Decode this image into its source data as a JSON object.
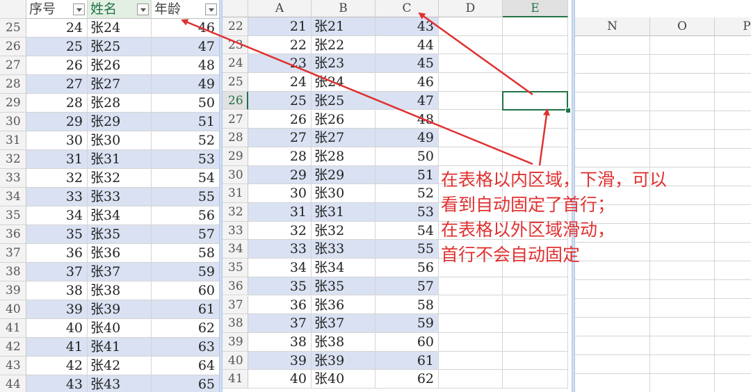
{
  "left_pane": {
    "headers": [
      "序号",
      "姓名",
      "年龄"
    ],
    "rows": [
      {
        "r": "25",
        "a": "24",
        "b": "张24",
        "c": "46"
      },
      {
        "r": "26",
        "a": "25",
        "b": "张25",
        "c": "47"
      },
      {
        "r": "27",
        "a": "26",
        "b": "张26",
        "c": "48"
      },
      {
        "r": "28",
        "a": "27",
        "b": "张27",
        "c": "49"
      },
      {
        "r": "29",
        "a": "28",
        "b": "张28",
        "c": "50"
      },
      {
        "r": "30",
        "a": "29",
        "b": "张29",
        "c": "51"
      },
      {
        "r": "31",
        "a": "30",
        "b": "张30",
        "c": "52"
      },
      {
        "r": "32",
        "a": "31",
        "b": "张31",
        "c": "53"
      },
      {
        "r": "33",
        "a": "32",
        "b": "张32",
        "c": "54"
      },
      {
        "r": "34",
        "a": "33",
        "b": "张33",
        "c": "55"
      },
      {
        "r": "35",
        "a": "34",
        "b": "张34",
        "c": "56"
      },
      {
        "r": "36",
        "a": "35",
        "b": "张35",
        "c": "57"
      },
      {
        "r": "37",
        "a": "36",
        "b": "张36",
        "c": "58"
      },
      {
        "r": "38",
        "a": "37",
        "b": "张37",
        "c": "59"
      },
      {
        "r": "39",
        "a": "38",
        "b": "张38",
        "c": "60"
      },
      {
        "r": "40",
        "a": "39",
        "b": "张39",
        "c": "61"
      },
      {
        "r": "41",
        "a": "40",
        "b": "张40",
        "c": "62"
      },
      {
        "r": "42",
        "a": "41",
        "b": "张41",
        "c": "63"
      },
      {
        "r": "43",
        "a": "42",
        "b": "张42",
        "c": "64"
      },
      {
        "r": "44",
        "a": "43",
        "b": "张43",
        "c": "65"
      }
    ]
  },
  "right_pane": {
    "columns": [
      "A",
      "B",
      "C",
      "D",
      "E"
    ],
    "selected_column": "E",
    "selected_row": "26",
    "rows": [
      {
        "r": "22",
        "a": "21",
        "b": "张21",
        "c": "43"
      },
      {
        "r": "23",
        "a": "22",
        "b": "张22",
        "c": "44"
      },
      {
        "r": "24",
        "a": "23",
        "b": "张23",
        "c": "45"
      },
      {
        "r": "25",
        "a": "24",
        "b": "张24",
        "c": "46"
      },
      {
        "r": "26",
        "a": "25",
        "b": "张25",
        "c": "47"
      },
      {
        "r": "27",
        "a": "26",
        "b": "张26",
        "c": "48"
      },
      {
        "r": "28",
        "a": "27",
        "b": "张27",
        "c": "49"
      },
      {
        "r": "29",
        "a": "28",
        "b": "张28",
        "c": "50"
      },
      {
        "r": "30",
        "a": "29",
        "b": "张29",
        "c": "51"
      },
      {
        "r": "31",
        "a": "30",
        "b": "张30",
        "c": "52"
      },
      {
        "r": "32",
        "a": "31",
        "b": "张31",
        "c": "53"
      },
      {
        "r": "33",
        "a": "32",
        "b": "张32",
        "c": "54"
      },
      {
        "r": "34",
        "a": "33",
        "b": "张33",
        "c": "55"
      },
      {
        "r": "35",
        "a": "34",
        "b": "张34",
        "c": "56"
      },
      {
        "r": "36",
        "a": "35",
        "b": "张35",
        "c": "57"
      },
      {
        "r": "37",
        "a": "36",
        "b": "张36",
        "c": "58"
      },
      {
        "r": "38",
        "a": "37",
        "b": "张37",
        "c": "59"
      },
      {
        "r": "39",
        "a": "38",
        "b": "张38",
        "c": "60"
      },
      {
        "r": "40",
        "a": "39",
        "b": "张39",
        "c": "61"
      },
      {
        "r": "41",
        "a": "40",
        "b": "张40",
        "c": "62"
      }
    ]
  },
  "far_pane": {
    "columns": [
      "N",
      "O",
      "P"
    ]
  },
  "annotation": {
    "lines": [
      "在表格以内区域，下滑，可以",
      "看到自动固定了首行；",
      "在表格以外区域滑动，",
      "首行不会自动固定"
    ]
  },
  "colors": {
    "band": "#d9e1f2",
    "accent_green": "#217346",
    "annotation_red": "#e03131"
  }
}
